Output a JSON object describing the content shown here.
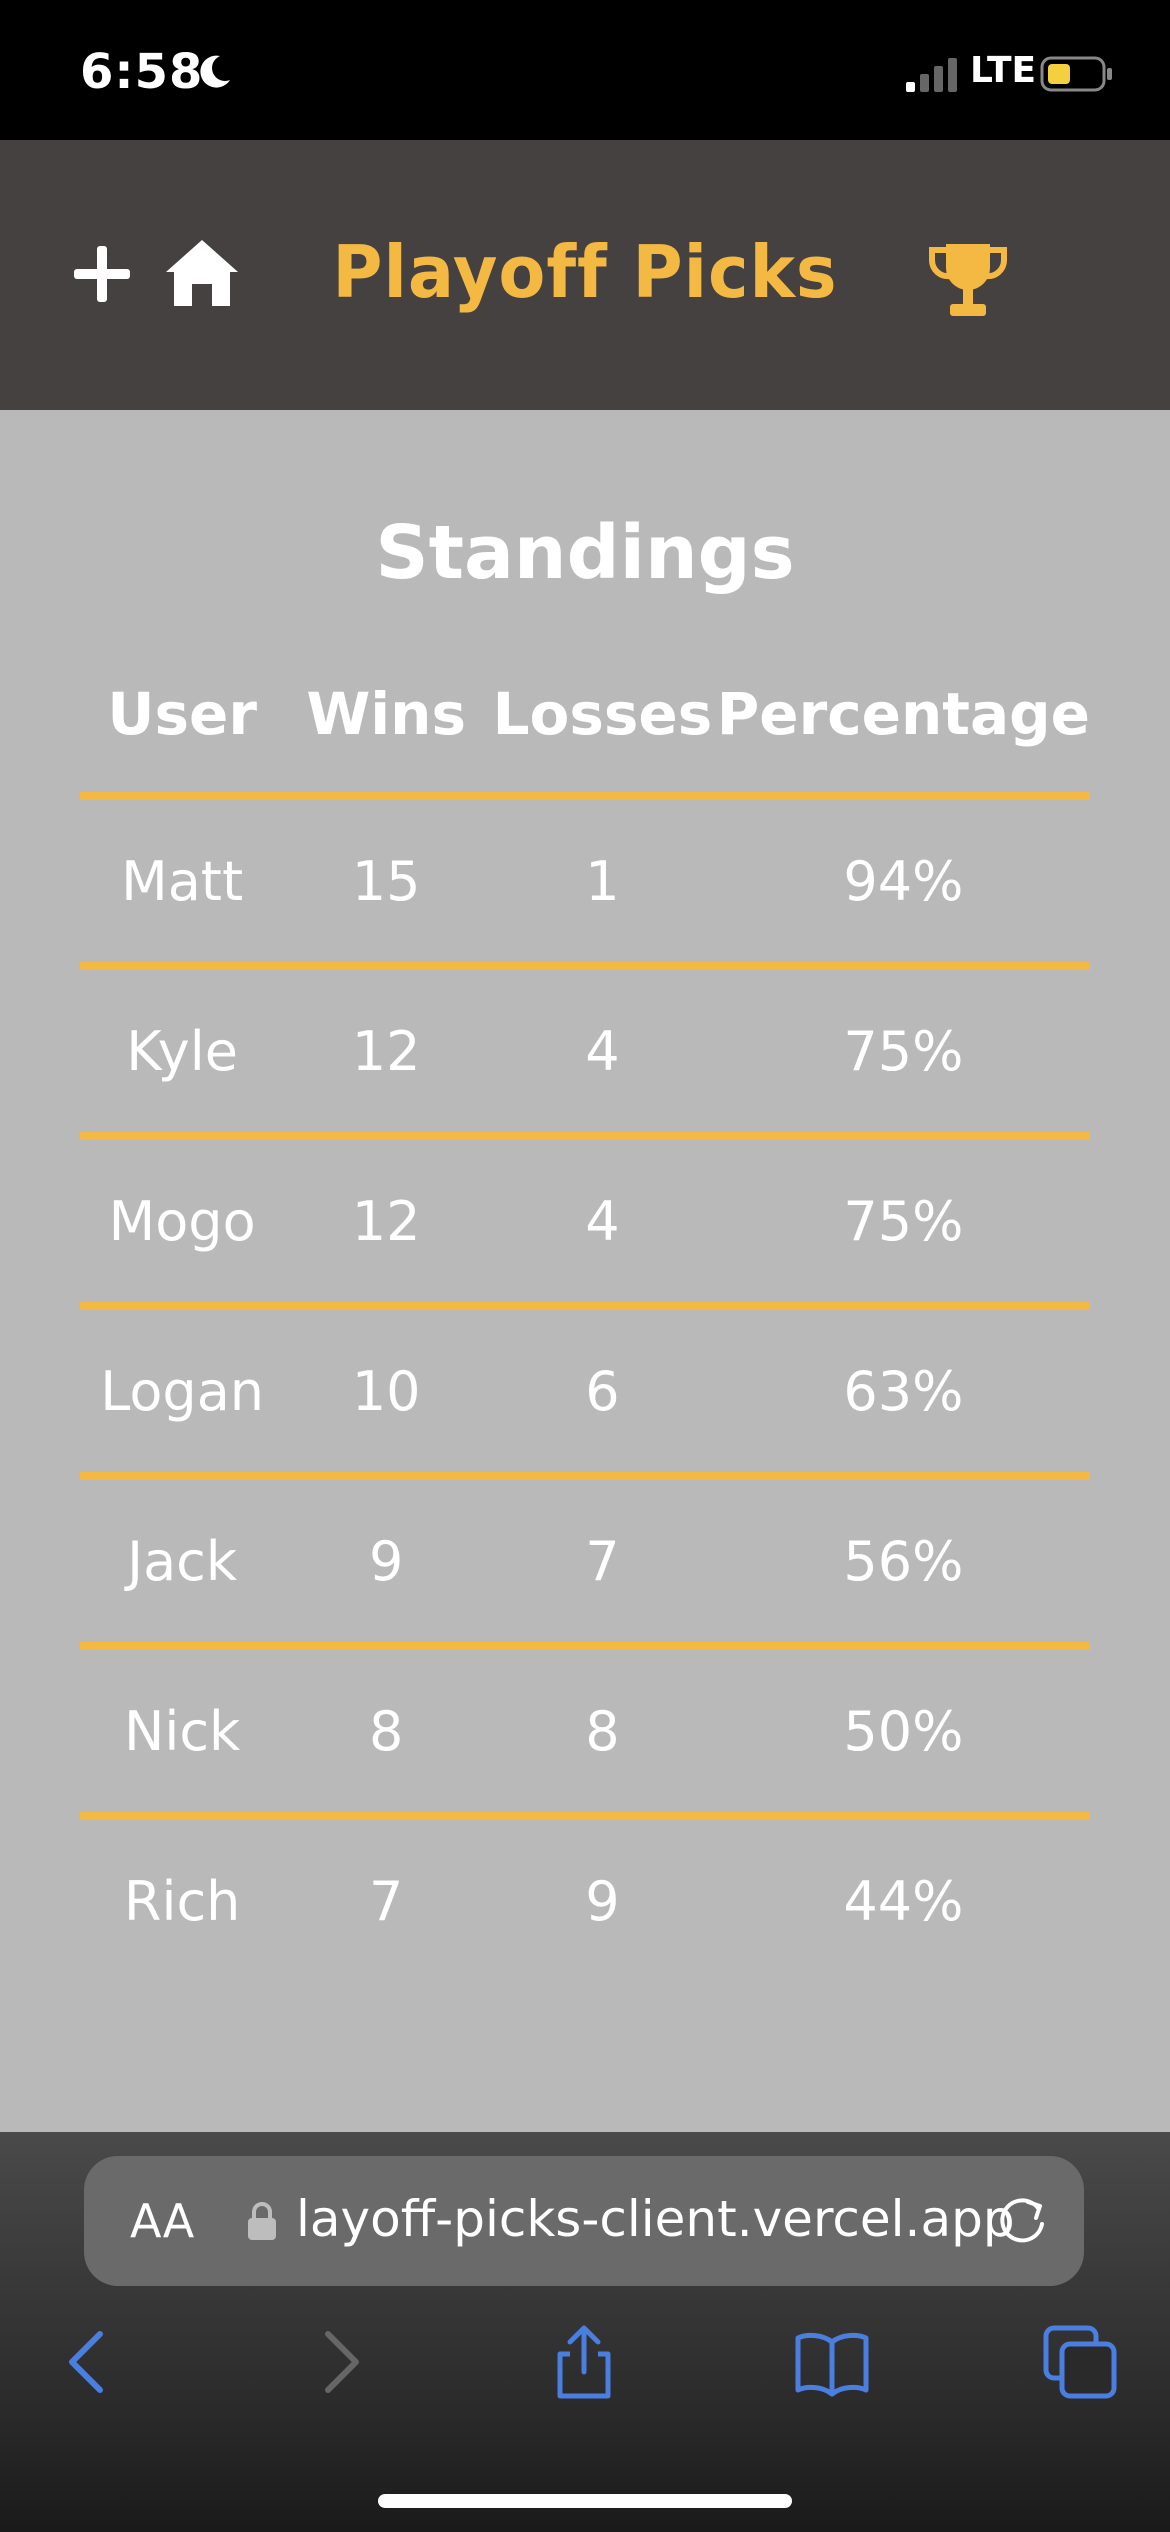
{
  "status_bar": {
    "time": "6:58",
    "carrier": "LTE"
  },
  "header": {
    "brand": "Playoff Picks"
  },
  "standings": {
    "title": "Standings",
    "columns": [
      "User",
      "Wins",
      "Losses",
      "Percentage"
    ],
    "rows": [
      [
        "Matt",
        "15",
        "1",
        "94%"
      ],
      [
        "Kyle",
        "12",
        "4",
        "75%"
      ],
      [
        "Mogo",
        "12",
        "4",
        "75%"
      ],
      [
        "Logan",
        "10",
        "6",
        "63%"
      ],
      [
        "Jack",
        "9",
        "7",
        "56%"
      ],
      [
        "Nick",
        "8",
        "8",
        "50%"
      ],
      [
        "Rich",
        "7",
        "9",
        "44%"
      ]
    ]
  },
  "browser": {
    "text_size_label": "AA",
    "url": "layoff-picks-client.vercel.app"
  },
  "colors": {
    "accent": "#f4b942",
    "header_bg": "#454141",
    "page_bg": "#b9b9b9",
    "browser_blue": "#4a7fe0"
  },
  "icons": {
    "header": [
      "plus-icon",
      "home-icon",
      "trophy-icon"
    ],
    "browser": [
      "lock-icon",
      "reload-icon",
      "back-icon",
      "forward-icon",
      "share-icon",
      "bookmarks-icon",
      "tabs-icon"
    ]
  }
}
